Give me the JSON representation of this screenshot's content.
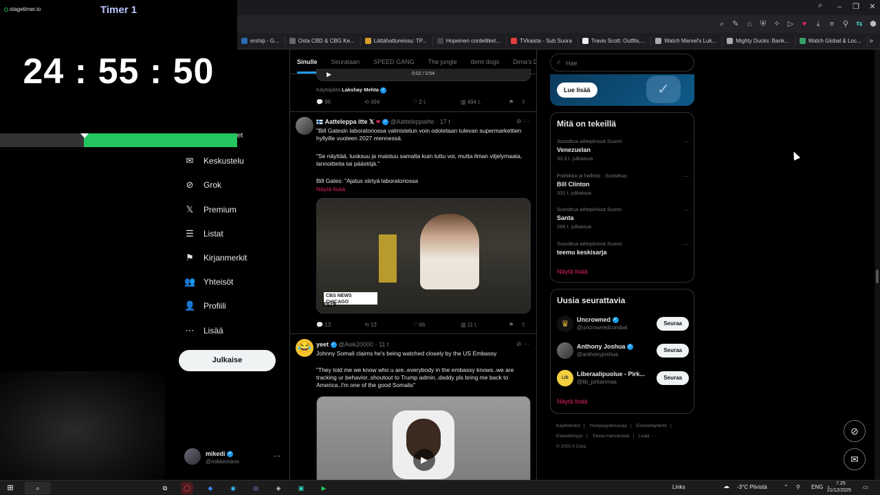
{
  "stagetimer": {
    "brand": "stagetimer.io",
    "title": "Timer 1",
    "time": "24 : 55 : 50",
    "progress_remaining_fraction": 0.645,
    "partial_label": "et"
  },
  "browser": {
    "bookmarks": [
      {
        "label": "ership - G...",
        "color": "#2b6cb0"
      },
      {
        "label": "Osta CBD & CBG Ke...",
        "color": "#666"
      },
      {
        "label": "Lättähattureissu: TP...",
        "color": "#d69e2e"
      },
      {
        "label": "Hopeinen cordelliket...",
        "color": "#444"
      },
      {
        "label": "TVkaista - Sub Suora",
        "color": "#e53e3e"
      },
      {
        "label": "Travis Scott: Outfits,...",
        "color": "#eee"
      },
      {
        "label": "Watch Marvel's Luk...",
        "color": "#aaa"
      },
      {
        "label": "Mighty Ducks: Bank...",
        "color": "#aaa"
      },
      {
        "label": "Watch Global & Loc...",
        "color": "#38a169"
      }
    ]
  },
  "nav": {
    "items": [
      {
        "label": "Keskustelu",
        "icon": "envelope-icon",
        "glyph": "✉"
      },
      {
        "label": "Grok",
        "icon": "grok-icon",
        "glyph": "⊘"
      },
      {
        "label": "Premium",
        "icon": "x-logo-icon",
        "glyph": "𝕏"
      },
      {
        "label": "Listat",
        "icon": "list-icon",
        "glyph": "☰"
      },
      {
        "label": "Kirjanmerkit",
        "icon": "bookmark-icon",
        "glyph": "⚑"
      },
      {
        "label": "Yhteisöt",
        "icon": "communities-icon",
        "glyph": "👥"
      },
      {
        "label": "Profiili",
        "icon": "profile-icon",
        "glyph": "👤"
      },
      {
        "label": "Lisää",
        "icon": "more-circle-icon",
        "glyph": "⋯"
      }
    ],
    "post_button": "Julkaise",
    "user": {
      "name": "mikedi",
      "handle": "@mikkemane"
    }
  },
  "feed": {
    "tabs": [
      "Sinulle",
      "Seurataan",
      "SPEED GANG",
      "The jungle",
      "demi dogs",
      "Dima's D"
    ],
    "video_time_partial": "0:02 / 0:54",
    "used_by": "Käyttäjältä",
    "used_by_name": "Lakshay Mehta",
    "t0_actions": {
      "replies": "96",
      "reposts": "494",
      "likes": "2 t.",
      "views": "494 t."
    },
    "t1": {
      "name": "Aatteleppa itte",
      "handle": "@Aatteleppaitte",
      "time": "17 t",
      "p1": "\"Bill Gatesin laboratoriossa valmistetun voin odotetaan tulevan supermarkettien hyllyille vuoteen 2027 mennessä.",
      "p2": "\"Se näyttää, tuoksuu ja maistuu samalta kuin tuttu voi, mutta ilman viljelymaata, lannoitteita tai päästöjä.\"",
      "p3": "Bill Gates: \"Ajatus siirtyä laboratoriossa",
      "show_more": "Näytä lisää",
      "video_duration": "1:41",
      "video_caption": "CBS NEWS CHICAGO",
      "actions": {
        "replies": "13",
        "reposts": "13",
        "likes": "66",
        "views": "11 t."
      }
    },
    "t2": {
      "name": "yeet",
      "handle": "@Awk20000",
      "time": "11 t",
      "p1": "Johnny Somali claims he's being watched closely by the US Embassy",
      "p2": "\"They told me we know who u are..everybody in the embassy knows..we are tracking ur behavior..shoutout to Trump admin..daddy pls bring me back to America..I'm one of the good Somalis\""
    }
  },
  "sidebar": {
    "search_placeholder": "Hae",
    "promo_button": "Lue lisää",
    "trends_title": "Mitä on tekeillä",
    "trends": [
      {
        "context": "Suosittua aihepiirissä Suomi",
        "topic": "Venezuelan",
        "posts": "33,3 t. julkaisua"
      },
      {
        "context": "Politiikka ja hallinto · Suosittua",
        "topic": "Bill Clinton",
        "posts": "331 t. julkaisua"
      },
      {
        "context": "Suosittua aihepiirissä Suomi",
        "topic": "Santa",
        "posts": "266 t. julkaisua"
      },
      {
        "context": "Suosittua aihepiirissä Suomi",
        "topic": "teemu keskisarja",
        "posts": ""
      }
    ],
    "trends_more": "Näytä lisää",
    "who_title": "Uusia seurattavia",
    "who": [
      {
        "name": "Uncrowned",
        "handle": "@uncrownedcombat",
        "button": "Seuraa",
        "color": "#222"
      },
      {
        "name": "Anthony Joshua",
        "handle": "@anthonyjoshua",
        "button": "Seuraa",
        "color": "#444"
      },
      {
        "name": "Liberaalipuolue - Pirk...",
        "handle": "@lib_pirkanmaa",
        "button": "Seuraa",
        "color": "#f4d03f"
      }
    ],
    "who_more": "Näytä lisää",
    "footer": [
      "Käyttöehdot",
      "Yksityisyydensuoja",
      "Evästekäytäntö",
      "Esteettömyys",
      "Tietoa mainoksista",
      "Lisää ···",
      "© 2025 X Corp."
    ]
  },
  "taskbar": {
    "links": "Links",
    "weather": "-3°C Pilvistä",
    "lang": "ENG",
    "time": "7.25",
    "date": "21/12/2025"
  }
}
